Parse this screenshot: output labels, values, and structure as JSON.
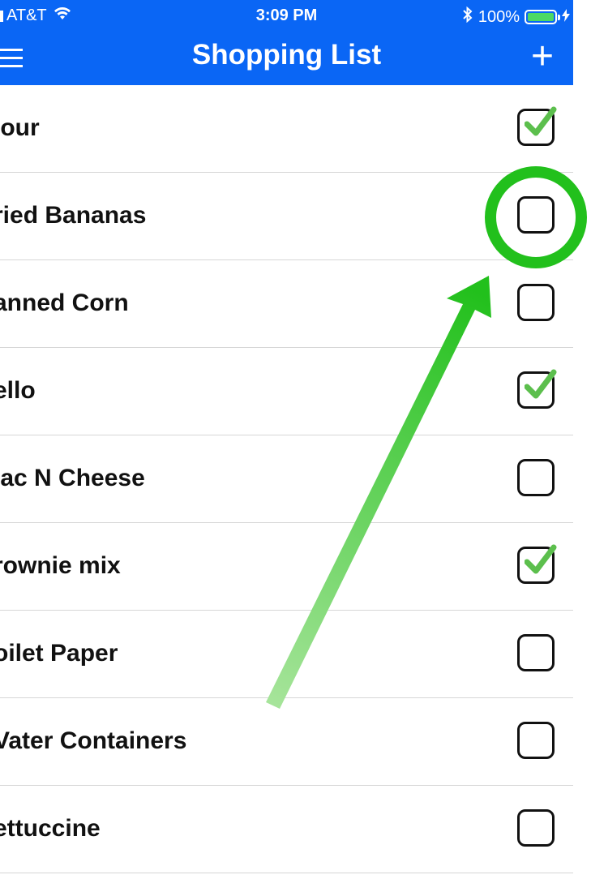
{
  "status_bar": {
    "carrier": "AT&T",
    "time": "3:09 PM",
    "battery": "100%"
  },
  "nav": {
    "title": "Shopping List",
    "add_label": "+"
  },
  "items": [
    {
      "label": "lour",
      "checked": true
    },
    {
      "label": "ried Bananas",
      "checked": false
    },
    {
      "label": "anned Corn",
      "checked": false
    },
    {
      "label": "ello",
      "checked": true
    },
    {
      "label": "lac N Cheese",
      "checked": false
    },
    {
      "label": "rownie mix",
      "checked": true
    },
    {
      "label": "oilet Paper",
      "checked": false
    },
    {
      "label": "Vater Containers",
      "checked": false
    },
    {
      "label": "ettuccine",
      "checked": false
    }
  ],
  "colors": {
    "nav_background": "#0a66f5",
    "checkmark": "#5cbf4d",
    "annotation": "#22c01c"
  },
  "icons": {
    "menu": "hamburger-icon",
    "add": "plus-icon",
    "wifi": "wifi-icon",
    "bluetooth": "bluetooth-icon",
    "battery": "battery-icon",
    "checkbox": "checkbox-icon",
    "check": "checkmark-icon"
  }
}
